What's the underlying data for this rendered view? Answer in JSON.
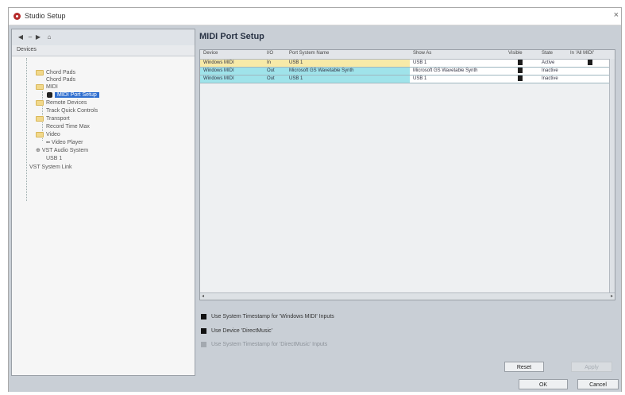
{
  "window": {
    "title": "Studio Setup",
    "close_glyph": "×"
  },
  "nav": {
    "back": "◀",
    "forward": "▶",
    "home": "⌂",
    "separator": "–"
  },
  "devices": {
    "header": "Devices",
    "tree": [
      "Chord Pads",
      "Chord Pads",
      "MIDI",
      "MIDI Port Setup",
      "Remote Devices",
      "Track Quick Controls",
      "Transport",
      "Record Time Max",
      "Video",
      "Video Player",
      "VST Audio System",
      "USB 1",
      "VST System Link"
    ]
  },
  "page": {
    "title": "MIDI Port Setup"
  },
  "table": {
    "columns": [
      "Device",
      "I/O",
      "Port System Name",
      "Show As",
      "Visible",
      "State",
      "In 'All MIDI'"
    ],
    "rows": [
      {
        "device": "Windows MIDI",
        "io": "In",
        "port": "USB 1",
        "show_as": "USB 1",
        "state": "Active",
        "color": "#f7eaa8"
      },
      {
        "device": "Windows MIDI",
        "io": "Out",
        "port": "Microsoft GS Wavetable Synth",
        "show_as": "Microsoft GS Wavetable Synth",
        "state": "Inactive",
        "color": "#9fe3ea"
      },
      {
        "device": "Windows MIDI",
        "io": "Out",
        "port": "USB 1",
        "show_as": "USB 1",
        "state": "Inactive",
        "color": "#9fe3ea"
      }
    ]
  },
  "options": [
    {
      "label": "Use System Timestamp for 'Windows MIDI' Inputs",
      "enabled": true
    },
    {
      "label": "Use Device 'DirectMusic'",
      "enabled": true
    },
    {
      "label": "Use System Timestamp for 'DirectMusic' Inputs",
      "enabled": false
    }
  ],
  "buttons": {
    "reset": "Reset",
    "apply": "Apply",
    "ok": "OK",
    "cancel": "Cancel"
  },
  "colors": {
    "selection": "#2f6fcf",
    "in_row": "#f7eaa8",
    "out_row": "#9fe3ea",
    "panel": "#c9cfd6"
  }
}
